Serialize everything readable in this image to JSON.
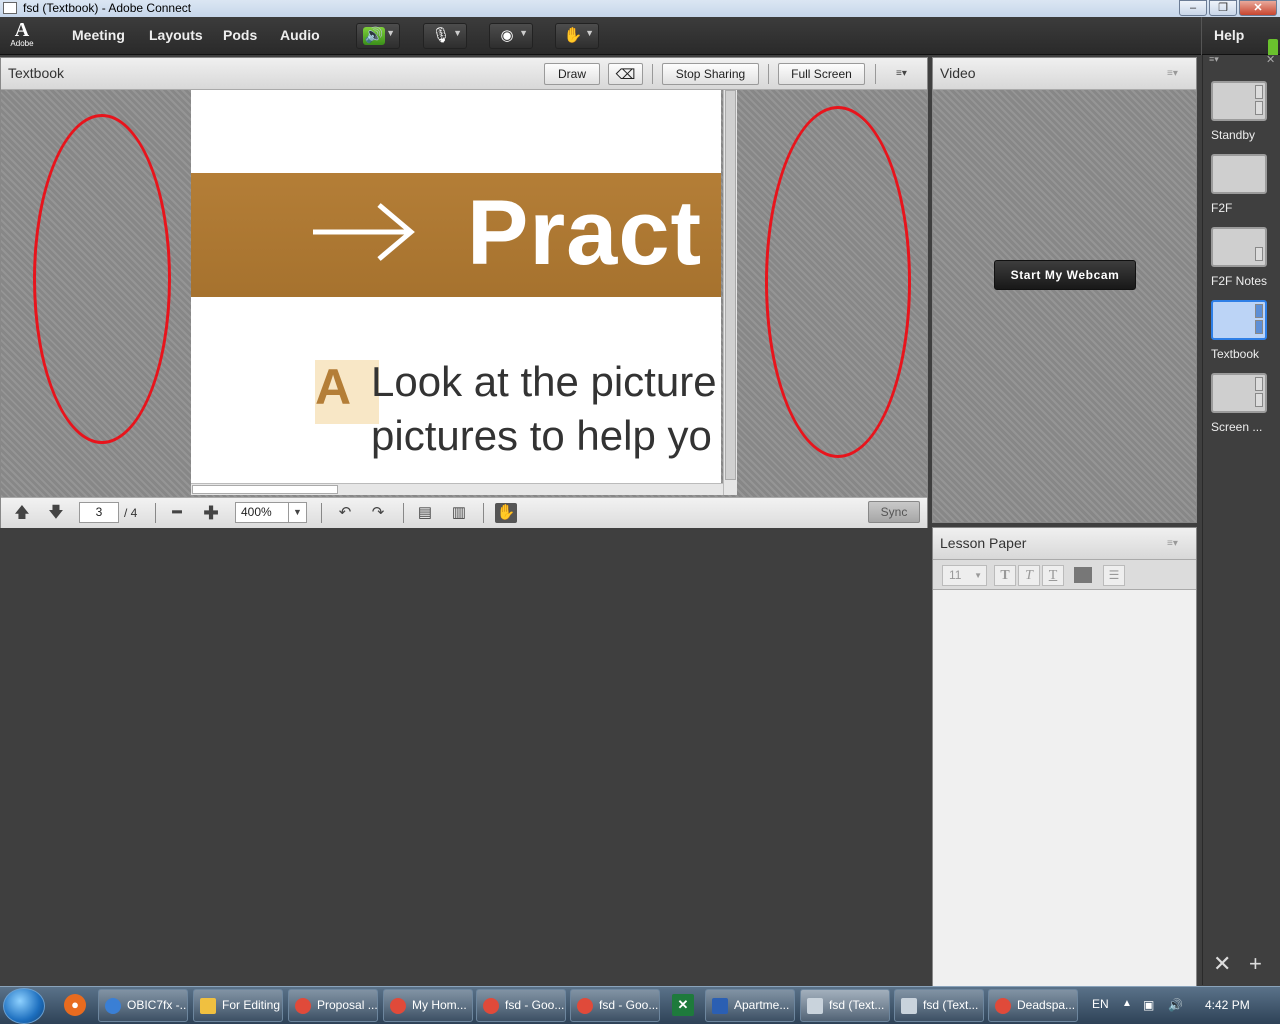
{
  "window": {
    "title": "fsd (Textbook) - Adobe Connect",
    "min": "–",
    "max": "❐",
    "close": "✕"
  },
  "menubar": {
    "logo_text": "Adobe",
    "items": [
      "Meeting",
      "Layouts",
      "Pods",
      "Audio"
    ],
    "help": "Help"
  },
  "textbook_pod": {
    "title": "Textbook",
    "draw": "Draw",
    "stop_sharing": "Stop Sharing",
    "full_screen": "Full Screen",
    "document": {
      "band_text": "Pract",
      "letter": "A",
      "line1": "Look at the picture",
      "line2": "pictures to help yo"
    },
    "toolbar": {
      "page": "3",
      "total_pages": "/ 4",
      "zoom": "400%",
      "sync": "Sync"
    }
  },
  "video_pod": {
    "title": "Video",
    "webcam_button": "Start My Webcam"
  },
  "lesson_pod": {
    "title": "Lesson Paper",
    "font_size": "11"
  },
  "layouts": [
    {
      "label": "Standby"
    },
    {
      "label": "F2F"
    },
    {
      "label": "F2F Notes"
    },
    {
      "label": "Textbook",
      "active": true
    },
    {
      "label": "Screen ..."
    }
  ],
  "taskbar": {
    "tasks": [
      {
        "label": "OBIC7fx -...",
        "color": "#3a7fd5"
      },
      {
        "label": "For Editing",
        "color": "#f0c040"
      },
      {
        "label": "Proposal ...",
        "color": "#e04a3a"
      },
      {
        "label": "My Hom...",
        "color": "#e04a3a"
      },
      {
        "label": "fsd - Goo...",
        "color": "#e04a3a"
      },
      {
        "label": "fsd - Goo...",
        "color": "#e04a3a"
      },
      {
        "label": "Apartme...",
        "color": "#2b5fb3"
      },
      {
        "label": "fsd (Text...",
        "color": "#c9d3dc"
      },
      {
        "label": "fsd (Text...",
        "color": "#c9d3dc"
      },
      {
        "label": "Deadspa...",
        "color": "#e04a3a"
      }
    ],
    "language": "EN",
    "clock": "4:42 PM"
  },
  "colors": {
    "annotation_ellipse": "#e8141c",
    "audio_active": "#6ac12d",
    "band": "#b47e37"
  }
}
